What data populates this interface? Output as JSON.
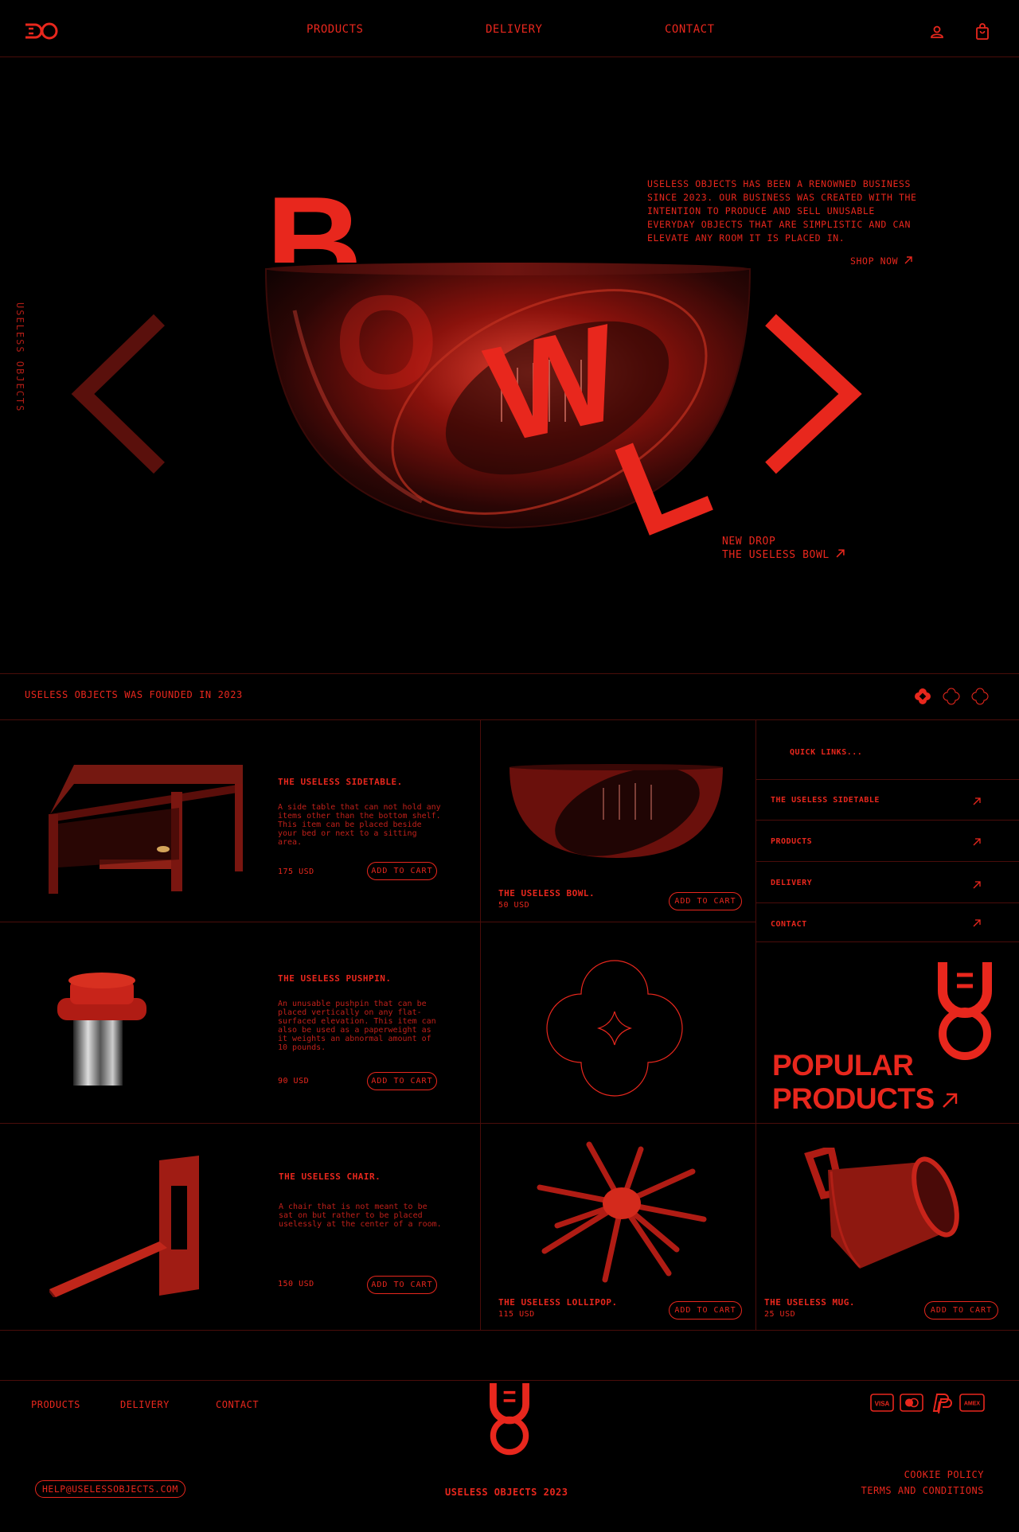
{
  "brand": {
    "logo_text": "UO"
  },
  "nav": {
    "products": "PRODUCTS",
    "delivery": "DELIVERY",
    "contact": "CONTACT"
  },
  "icons": {
    "account": "user-icon",
    "cart": "shopping-bag-icon"
  },
  "hero": {
    "vertical_text": "USELESS OBJECTS",
    "big_word": [
      "B",
      "O",
      "W",
      "L"
    ],
    "about": "USELESS OBJECTS HAS BEEN A RENOWNED BUSINESS SINCE 2023. OUR BUSINESS WAS CREATED WITH THE INTENTION TO PRODUCE AND SELL UNUSABLE EVERYDAY OBJECTS THAT ARE SIMPLISTIC AND CAN ELEVATE ANY ROOM IT IS PLACED IN.",
    "shop_now": "SHOP NOW",
    "drop_line1": "NEW DROP",
    "drop_line2": "THE USELESS BOWL"
  },
  "banner": {
    "text": "USELESS OBJECTS WAS FOUNDED IN 2023"
  },
  "products": {
    "sidetable": {
      "title": "THE USELESS SIDETABLE.",
      "desc": "A side table that can not hold any items other than the bottom shelf. This item can be placed beside your bed or next to a sitting area.",
      "price": "175 USD",
      "cta": "ADD TO CART"
    },
    "bowl": {
      "title": "THE USELESS BOWL.",
      "price": "50 USD",
      "cta": "ADD TO CART"
    },
    "pushpin": {
      "title": "THE USELESS PUSHPIN.",
      "desc": "An unusable pushpin that can be placed vertically on any flat-surfaced elevation. This item can also be used as a paperweight as it weights an abnormal amount of 10 pounds.",
      "price": "90 USD",
      "cta": "ADD TO CART"
    },
    "chair": {
      "title": "THE USELESS CHAIR.",
      "desc": "A chair that is not meant to be sat on but rather to be placed uselessly at the center of a room.",
      "price": "150 USD",
      "cta": "ADD TO CART"
    },
    "lollipop": {
      "title": "THE USELESS LOLLIPOP.",
      "price": "115 USD",
      "cta": "ADD TO CART"
    },
    "mug": {
      "title": "THE USELESS MUG.",
      "price": "25 USD",
      "cta": "ADD TO CART"
    }
  },
  "quick_links": {
    "title": "QUICK LINKS...",
    "items": [
      "THE USELESS SIDETABLE",
      "PRODUCTS",
      "DELIVERY",
      "CONTACT"
    ]
  },
  "popular": {
    "line1": "POPULAR",
    "line2": "PRODUCTS"
  },
  "footer": {
    "nav": [
      "PRODUCTS",
      "DELIVERY",
      "CONTACT"
    ],
    "email": "HELP@USELESSOBJECTS.COM",
    "copyright": "USELESS OBJECTS 2023",
    "cookie": "COOKIE POLICY",
    "terms": "TERMS AND CONDITIONS",
    "payments": [
      "VISA",
      "MASTERCARD",
      "PAYPAL",
      "AMEX"
    ],
    "payment_labels": {
      "visa": "VISA",
      "amex": "AMEX"
    }
  }
}
